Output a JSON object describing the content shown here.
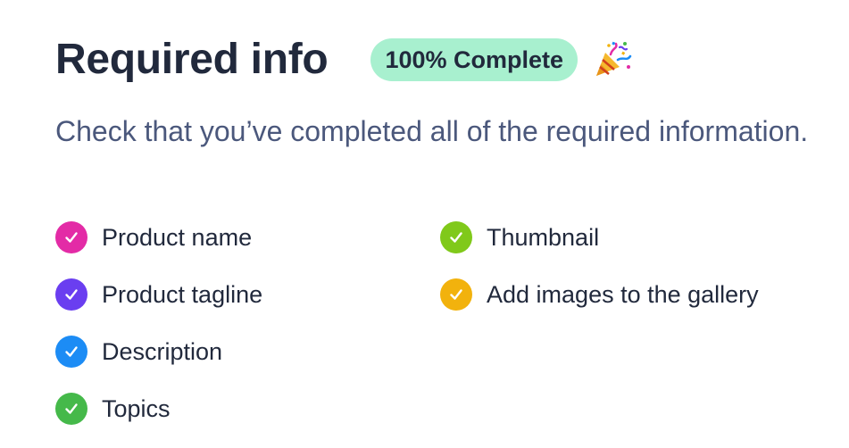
{
  "header": {
    "title": "Required info",
    "badge": "100% Complete",
    "celebration_icon": "party-popper-icon"
  },
  "subtitle": "Check that you’ve completed all of the required information.",
  "checklist": {
    "items": [
      {
        "label": "Product name",
        "color": "#e32ba6",
        "icon": "check-icon"
      },
      {
        "label": "Thumbnail",
        "color": "#80c91a",
        "icon": "check-icon"
      },
      {
        "label": "Product tagline",
        "color": "#6a3ef0",
        "icon": "check-icon"
      },
      {
        "label": "Add images to the gallery",
        "color": "#f2b20d",
        "icon": "check-icon"
      },
      {
        "label": "Description",
        "color": "#1c8cf5",
        "icon": "check-icon"
      },
      {
        "label": "Topics",
        "color": "#45b94a",
        "icon": "check-icon"
      }
    ]
  },
  "colors": {
    "badge_background": "#a8f0cf",
    "title_text": "#21293c",
    "subtitle_text": "#4b587c"
  }
}
